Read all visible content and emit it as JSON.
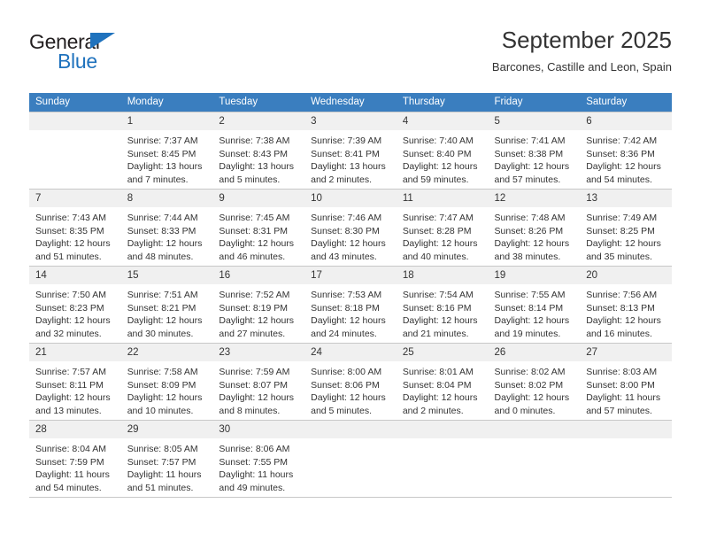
{
  "logo": {
    "word_top": "General",
    "word_bottom": "Blue",
    "triangle_icon": "triangle-icon",
    "brand_color": "#1f72bd"
  },
  "header": {
    "title": "September 2025",
    "subtitle": "Barcones, Castille and Leon, Spain"
  },
  "theme": {
    "header_bg": "#3a7ebf",
    "daynum_bg": "#f0f0f0",
    "grid_line": "#c8c8c8",
    "text": "#333333"
  },
  "columns": [
    "Sunday",
    "Monday",
    "Tuesday",
    "Wednesday",
    "Thursday",
    "Friday",
    "Saturday"
  ],
  "weeks": [
    [
      {
        "day": "",
        "lines": []
      },
      {
        "day": "1",
        "lines": [
          "Sunrise: 7:37 AM",
          "Sunset: 8:45 PM",
          "Daylight: 13 hours",
          "and 7 minutes."
        ]
      },
      {
        "day": "2",
        "lines": [
          "Sunrise: 7:38 AM",
          "Sunset: 8:43 PM",
          "Daylight: 13 hours",
          "and 5 minutes."
        ]
      },
      {
        "day": "3",
        "lines": [
          "Sunrise: 7:39 AM",
          "Sunset: 8:41 PM",
          "Daylight: 13 hours",
          "and 2 minutes."
        ]
      },
      {
        "day": "4",
        "lines": [
          "Sunrise: 7:40 AM",
          "Sunset: 8:40 PM",
          "Daylight: 12 hours",
          "and 59 minutes."
        ]
      },
      {
        "day": "5",
        "lines": [
          "Sunrise: 7:41 AM",
          "Sunset: 8:38 PM",
          "Daylight: 12 hours",
          "and 57 minutes."
        ]
      },
      {
        "day": "6",
        "lines": [
          "Sunrise: 7:42 AM",
          "Sunset: 8:36 PM",
          "Daylight: 12 hours",
          "and 54 minutes."
        ]
      }
    ],
    [
      {
        "day": "7",
        "lines": [
          "Sunrise: 7:43 AM",
          "Sunset: 8:35 PM",
          "Daylight: 12 hours",
          "and 51 minutes."
        ]
      },
      {
        "day": "8",
        "lines": [
          "Sunrise: 7:44 AM",
          "Sunset: 8:33 PM",
          "Daylight: 12 hours",
          "and 48 minutes."
        ]
      },
      {
        "day": "9",
        "lines": [
          "Sunrise: 7:45 AM",
          "Sunset: 8:31 PM",
          "Daylight: 12 hours",
          "and 46 minutes."
        ]
      },
      {
        "day": "10",
        "lines": [
          "Sunrise: 7:46 AM",
          "Sunset: 8:30 PM",
          "Daylight: 12 hours",
          "and 43 minutes."
        ]
      },
      {
        "day": "11",
        "lines": [
          "Sunrise: 7:47 AM",
          "Sunset: 8:28 PM",
          "Daylight: 12 hours",
          "and 40 minutes."
        ]
      },
      {
        "day": "12",
        "lines": [
          "Sunrise: 7:48 AM",
          "Sunset: 8:26 PM",
          "Daylight: 12 hours",
          "and 38 minutes."
        ]
      },
      {
        "day": "13",
        "lines": [
          "Sunrise: 7:49 AM",
          "Sunset: 8:25 PM",
          "Daylight: 12 hours",
          "and 35 minutes."
        ]
      }
    ],
    [
      {
        "day": "14",
        "lines": [
          "Sunrise: 7:50 AM",
          "Sunset: 8:23 PM",
          "Daylight: 12 hours",
          "and 32 minutes."
        ]
      },
      {
        "day": "15",
        "lines": [
          "Sunrise: 7:51 AM",
          "Sunset: 8:21 PM",
          "Daylight: 12 hours",
          "and 30 minutes."
        ]
      },
      {
        "day": "16",
        "lines": [
          "Sunrise: 7:52 AM",
          "Sunset: 8:19 PM",
          "Daylight: 12 hours",
          "and 27 minutes."
        ]
      },
      {
        "day": "17",
        "lines": [
          "Sunrise: 7:53 AM",
          "Sunset: 8:18 PM",
          "Daylight: 12 hours",
          "and 24 minutes."
        ]
      },
      {
        "day": "18",
        "lines": [
          "Sunrise: 7:54 AM",
          "Sunset: 8:16 PM",
          "Daylight: 12 hours",
          "and 21 minutes."
        ]
      },
      {
        "day": "19",
        "lines": [
          "Sunrise: 7:55 AM",
          "Sunset: 8:14 PM",
          "Daylight: 12 hours",
          "and 19 minutes."
        ]
      },
      {
        "day": "20",
        "lines": [
          "Sunrise: 7:56 AM",
          "Sunset: 8:13 PM",
          "Daylight: 12 hours",
          "and 16 minutes."
        ]
      }
    ],
    [
      {
        "day": "21",
        "lines": [
          "Sunrise: 7:57 AM",
          "Sunset: 8:11 PM",
          "Daylight: 12 hours",
          "and 13 minutes."
        ]
      },
      {
        "day": "22",
        "lines": [
          "Sunrise: 7:58 AM",
          "Sunset: 8:09 PM",
          "Daylight: 12 hours",
          "and 10 minutes."
        ]
      },
      {
        "day": "23",
        "lines": [
          "Sunrise: 7:59 AM",
          "Sunset: 8:07 PM",
          "Daylight: 12 hours",
          "and 8 minutes."
        ]
      },
      {
        "day": "24",
        "lines": [
          "Sunrise: 8:00 AM",
          "Sunset: 8:06 PM",
          "Daylight: 12 hours",
          "and 5 minutes."
        ]
      },
      {
        "day": "25",
        "lines": [
          "Sunrise: 8:01 AM",
          "Sunset: 8:04 PM",
          "Daylight: 12 hours",
          "and 2 minutes."
        ]
      },
      {
        "day": "26",
        "lines": [
          "Sunrise: 8:02 AM",
          "Sunset: 8:02 PM",
          "Daylight: 12 hours",
          "and 0 minutes."
        ]
      },
      {
        "day": "27",
        "lines": [
          "Sunrise: 8:03 AM",
          "Sunset: 8:00 PM",
          "Daylight: 11 hours",
          "and 57 minutes."
        ]
      }
    ],
    [
      {
        "day": "28",
        "lines": [
          "Sunrise: 8:04 AM",
          "Sunset: 7:59 PM",
          "Daylight: 11 hours",
          "and 54 minutes."
        ]
      },
      {
        "day": "29",
        "lines": [
          "Sunrise: 8:05 AM",
          "Sunset: 7:57 PM",
          "Daylight: 11 hours",
          "and 51 minutes."
        ]
      },
      {
        "day": "30",
        "lines": [
          "Sunrise: 8:06 AM",
          "Sunset: 7:55 PM",
          "Daylight: 11 hours",
          "and 49 minutes."
        ]
      },
      {
        "day": "",
        "lines": []
      },
      {
        "day": "",
        "lines": []
      },
      {
        "day": "",
        "lines": []
      },
      {
        "day": "",
        "lines": []
      }
    ]
  ]
}
